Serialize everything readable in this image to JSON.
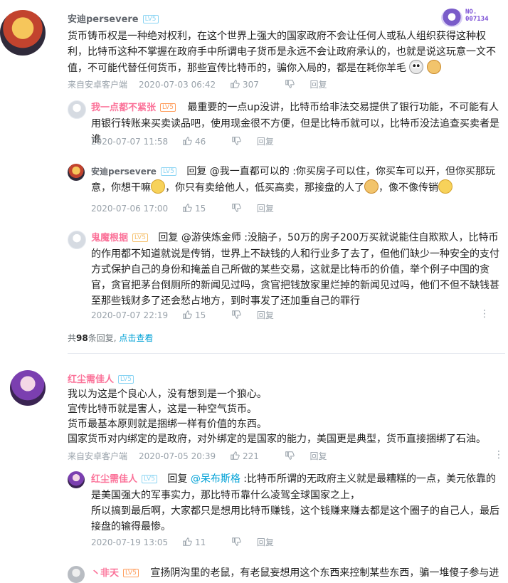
{
  "badge": {
    "label": "NO.",
    "number": "007134"
  },
  "comments": [
    {
      "user": "安迪persevere",
      "level": "LV5",
      "text": "货币铸币权是一种绝对权利，在这个世界上强大的国家政府不会让任何人或私人组织获得这种权利，比特币这种不掌握在政府手中所谓电子货币是永远不会让政府承认的，也就是说这玩意一文不值，不可能代替任何货币，那些宣传比特币的，骗你入局的，都是在耗你羊毛",
      "client": "来自安卓客户端",
      "date": "2020-07-03 06:42",
      "likes": "307",
      "reply_label": "回复",
      "replies": [
        {
          "user": "我一点都不紧张",
          "level": "LV5",
          "text": "最重要的一点up没讲，比特币给非法交易提供了银行功能，不可能有人用银行转账来买卖读品吧，使用现金很不方便，但是比特币就可以，比特币没法追查买卖者是谁",
          "date": "2020-07-07 11:58",
          "likes": "46",
          "reply_label": "回复"
        },
        {
          "user": "安迪persevere",
          "level": "LV5",
          "prefix": "回复 @我一直都可以的 :",
          "text_a": "你买房子可以住，你买车可以开，但你买那玩意，你想干嘛",
          "text_b": "，你只有卖给他人，低买高卖，那接盘的人了",
          "text_c": "，像不像传销",
          "date": "2020-07-06 17:00",
          "likes": "15",
          "reply_label": "回复"
        },
        {
          "user": "鬼魔根据",
          "level": "LV5",
          "prefix": "回复 @游侠炼金师 :",
          "text": "没脑子，50万的房子200万买就说能住自欺欺人，比特币的作用都不知道就说是传销，世界上不缺钱的人和行业多了去了，但他们缺少一种安全的支付方式保护自己的身份和掩盖自己所做的某些交易，这就是比特币的价值，举个例子中国的贪官，贪官把茅台倒厕所的新闻见过吗，贪官把钱放家里烂掉的新闻见过吗，他们不但不缺钱甚至那些钱财多了还会愁占地方，到时事发了还加重自己的罪行",
          "date": "2020-07-07 22:19",
          "likes": "15",
          "reply_label": "回复"
        }
      ],
      "more_prefix": "共",
      "more_count": "98",
      "more_suffix": "条回复,",
      "more_link": "点击查看"
    },
    {
      "user": "红尘需佳人",
      "level": "LV5",
      "lines": [
        "我以为这是个良心人，没有想到是一个狼心。",
        "宣传比特币就是害人，这是一种空气货币。",
        "货币最基本原则就是捆绑一样有价值的东西。",
        "国家货币对内绑定的是政府，对外绑定的是国家的能力，美国更是典型，货币直接捆绑了石油。"
      ],
      "client": "来自安卓客户端",
      "date": "2020-07-05 20:39",
      "likes": "221",
      "reply_label": "回复",
      "replies": [
        {
          "user": "红尘需佳人",
          "level": "LV5",
          "prefix": "回复 ",
          "mention": "@呆布斯格",
          "text": " :比特币所谓的无政府主义就是最糟糕的一点，美元依靠的是美国强大的军事实力，那比特币靠什么凌驾全球国家之上，",
          "text2": "所以搞到最后啊，大家都只是想用比特币赚钱，这个钱赚来赚去都是这个圈子的自己人，最后接盘的输得最惨。",
          "date": "2020-07-19 13:05",
          "likes": "11",
          "reply_label": "回复"
        },
        {
          "user": "丶非天",
          "level": "LV5",
          "text": "宣扬阴沟里的老鼠，有老鼠妄想用这个东西来控制某些东西，骗一堆傻子参与进"
        }
      ]
    }
  ],
  "colors": {
    "pink": "#fb7299",
    "blue": "#00a1d6",
    "gray": "#99a2aa"
  }
}
